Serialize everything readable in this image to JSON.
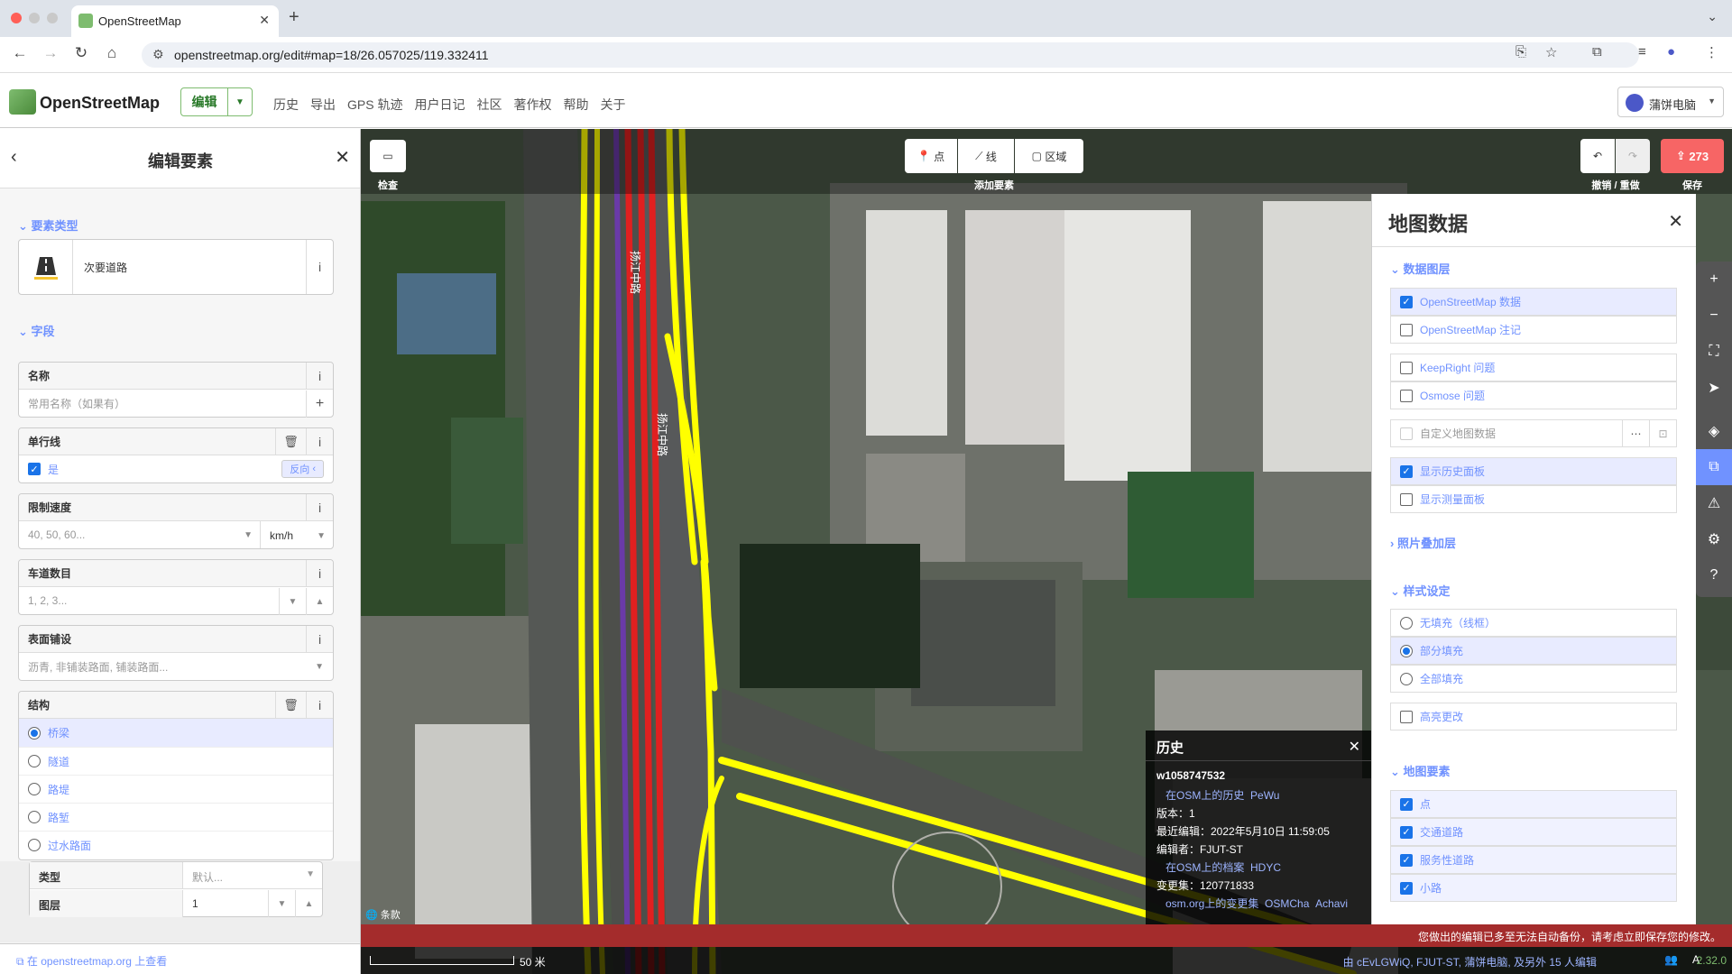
{
  "browser": {
    "tab_title": "OpenStreetMap",
    "url": "openstreetmap.org/edit#map=18/26.057025/119.332411"
  },
  "osm_header": {
    "brand": "OpenStreetMap",
    "edit_label": "编辑",
    "nav": [
      "历史",
      "导出",
      "GPS 轨迹",
      "用户日记",
      "社区",
      "著作权",
      "帮助",
      "关于"
    ],
    "user_name": "蒲饼电脑"
  },
  "left_panel": {
    "title": "编辑要素",
    "preset_section": "要素类型",
    "preset_name": "次要道路",
    "fields_section": "字段",
    "name_label": "名称",
    "name_placeholder": "常用名称（如果有）",
    "oneway_label": "单行线",
    "oneway_value": "是",
    "reverse_label": "反向",
    "maxspeed_label": "限制速度",
    "maxspeed_placeholder": "40, 50, 60...",
    "maxspeed_unit": "km/h",
    "lanes_label": "车道数目",
    "lanes_placeholder": "1, 2, 3...",
    "surface_label": "表面铺设",
    "surface_placeholder": "沥青, 非铺装路面, 铺装路面...",
    "structure_label": "结构",
    "structure_options": [
      "桥梁",
      "隧道",
      "路堤",
      "路堑",
      "过水路面"
    ],
    "structure_selected": 0,
    "type_label": "类型",
    "type_placeholder": "默认...",
    "layer_label": "图层",
    "layer_value": "1",
    "footer_link": "在 openstreetmap.org 上查看"
  },
  "map_toolbar": {
    "inspect_caption": "检查",
    "point": "点",
    "line": "线",
    "area": "区域",
    "add_caption": "添加要素",
    "undo_caption": "撤销 / 重做",
    "save_count": "273",
    "save_caption": "保存"
  },
  "right_panel": {
    "title": "地图数据",
    "data_layers": "数据图层",
    "layers": [
      {
        "label": "OpenStreetMap 数据",
        "checked": true
      },
      {
        "label": "OpenStreetMap 注记",
        "checked": false
      },
      {
        "label": "KeepRight 问题",
        "checked": false
      },
      {
        "label": "Osmose 问题",
        "checked": false
      }
    ],
    "custom_data": "自定义地图数据",
    "panels": [
      {
        "label": "显示历史面板",
        "checked": true
      },
      {
        "label": "显示测量面板",
        "checked": false
      }
    ],
    "photo_overlays": "照片叠加层",
    "style_section": "样式设定",
    "fill_options": [
      "无填充（线框）",
      "部分填充",
      "全部填充"
    ],
    "fill_selected": 1,
    "highlight_changes": "高亮更改",
    "map_features": "地图要素",
    "features": [
      "点",
      "交通道路",
      "服务性道路",
      "小路"
    ]
  },
  "history_panel": {
    "title": "历史",
    "way_id": "w1058747532",
    "osm_history_link": "在OSM上的历史",
    "pewu_link": "PeWu",
    "version": "版本：1",
    "last_edit": "最近编辑：2022年5月10日 11:59:05",
    "editor": "编辑者：FJUT-ST",
    "osm_profile_link": "在OSM上的档案",
    "hdyc_link": "HDYC",
    "changeset": "变更集：120771833",
    "osm_changeset_link": "osm.org上的变更集",
    "osmcha_link": "OSMCha",
    "achavi_link": "Achavi"
  },
  "bottom": {
    "error_message": "您做出的编辑已多至无法自动备份，请考虑立即保存您的修改。",
    "scale": "50 米",
    "attribution": "条款",
    "contributors": "由 cEvLGWiQ, FJUT-ST, 蒲饼电脑, 及另外 15 人编辑",
    "version": "2.32.0"
  },
  "colors": {
    "accent": "#7092ff",
    "osm_green": "#7ebc6f",
    "save_red": "#f76565",
    "error_red": "#a42c2c"
  }
}
